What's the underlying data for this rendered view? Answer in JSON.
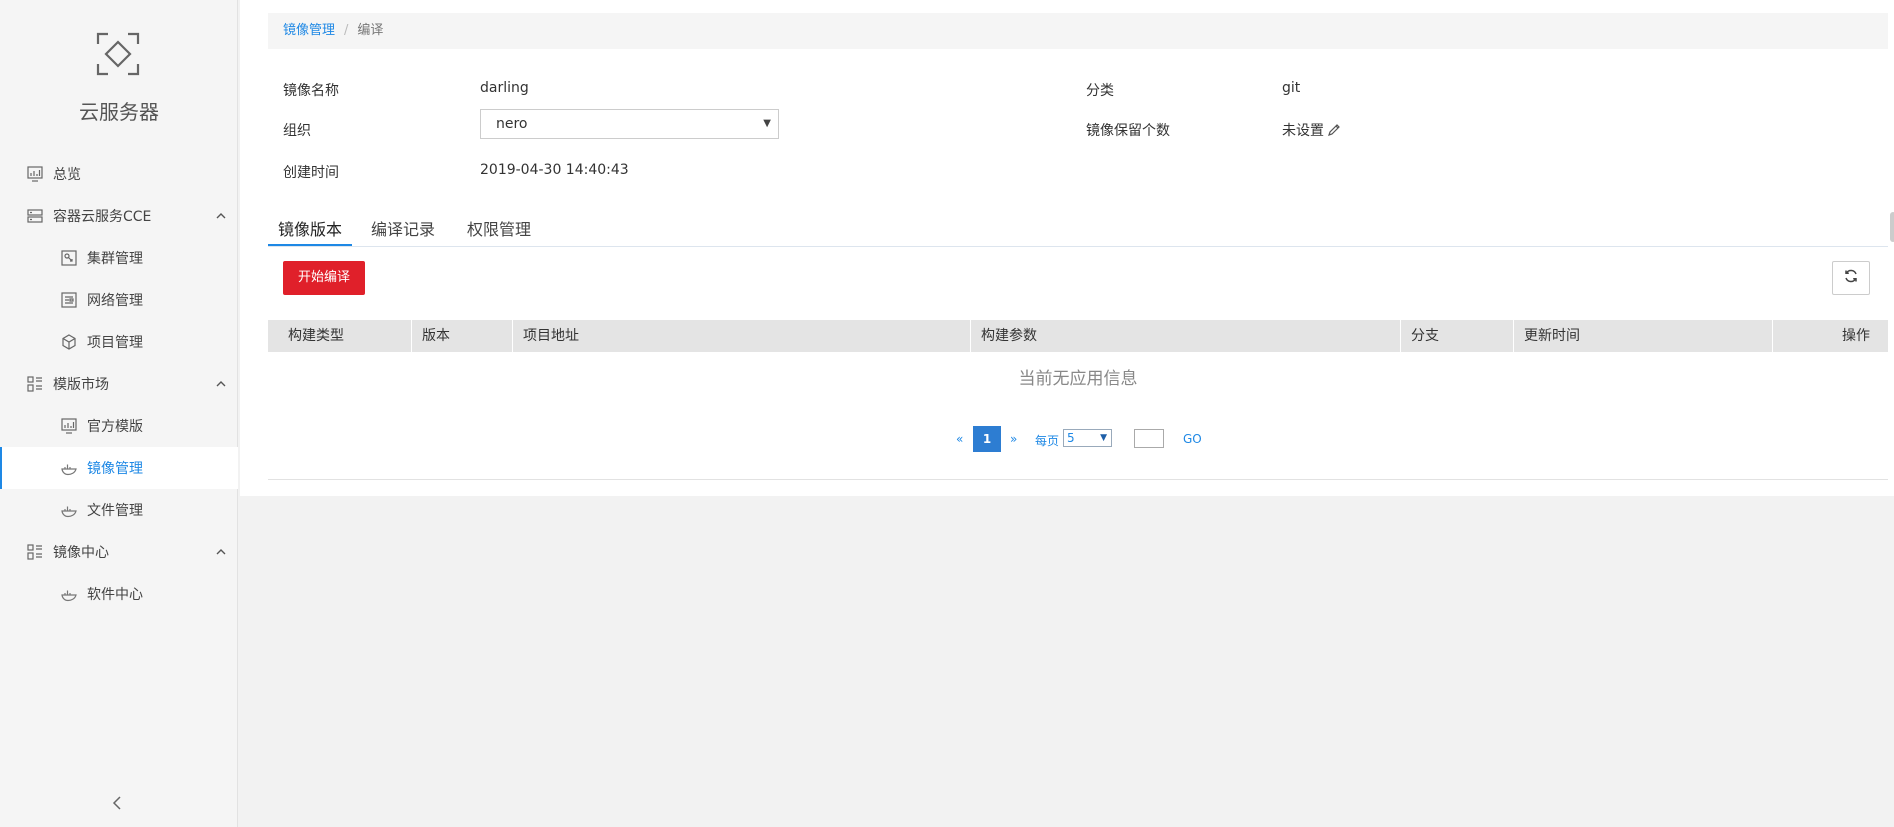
{
  "sidebar": {
    "brand": "云服务器",
    "items": [
      {
        "label": "总览",
        "icon": "monitor-chart-icon"
      },
      {
        "label": "容器云服务CCE",
        "icon": "server-icon",
        "expanded": true
      },
      {
        "label": "集群管理",
        "icon": "cluster-icon"
      },
      {
        "label": "网络管理",
        "icon": "network-icon"
      },
      {
        "label": "项目管理",
        "icon": "cube-icon"
      },
      {
        "label": "模版市场",
        "icon": "grid-icon",
        "expanded": true
      },
      {
        "label": "官方模版",
        "icon": "monitor-chart-icon"
      },
      {
        "label": "镜像管理",
        "icon": "whale-icon",
        "active": true
      },
      {
        "label": "文件管理",
        "icon": "whale-icon"
      },
      {
        "label": "镜像中心",
        "icon": "grid-icon",
        "expanded": true
      },
      {
        "label": "软件中心",
        "icon": "whale-icon"
      }
    ]
  },
  "breadcrumb": {
    "parent": "镜像管理",
    "separator": "/",
    "current": "编译"
  },
  "info": {
    "image_name_label": "镜像名称",
    "image_name_value": "darling",
    "org_label": "组织",
    "org_value": "nero",
    "created_label": "创建时间",
    "created_value": "2019-04-30 14:40:43",
    "category_label": "分类",
    "category_value": "git",
    "retain_label": "镜像保留个数",
    "retain_value": "未设置"
  },
  "tabs": [
    {
      "label": "镜像版本",
      "active": true
    },
    {
      "label": "编译记录",
      "active": false
    },
    {
      "label": "权限管理",
      "active": false
    }
  ],
  "toolbar": {
    "start_build_label": "开始编译"
  },
  "table": {
    "columns": [
      "构建类型",
      "版本",
      "项目地址",
      "构建参数",
      "分支",
      "更新时间",
      "操作"
    ],
    "rows": [],
    "empty_text": "当前无应用信息"
  },
  "pagination": {
    "prev": "«",
    "current_page": "1",
    "next": "»",
    "per_page_label": "每页",
    "per_page_value": "5",
    "go_label": "GO"
  },
  "colors": {
    "accent": "#1e88e5",
    "primary_button": "#e0202a",
    "page_active": "#2d7dd2"
  }
}
